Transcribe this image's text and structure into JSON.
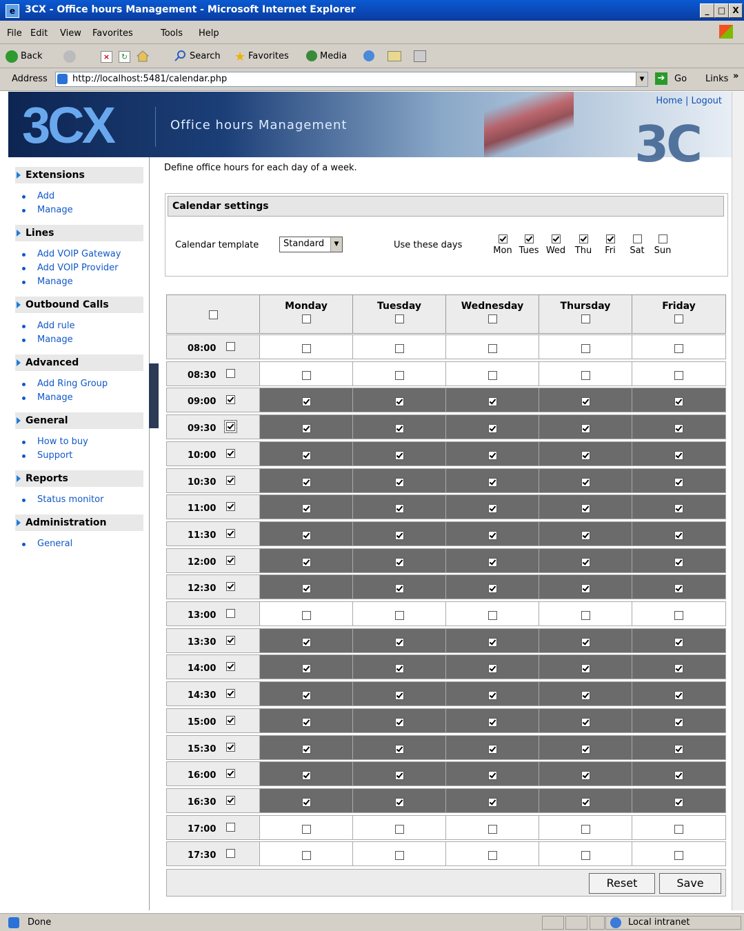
{
  "window": {
    "title": "3CX - Office hours Management - Microsoft Internet Explorer",
    "controls": [
      "_",
      "□",
      "X"
    ]
  },
  "menu": [
    "File",
    "Edit",
    "View",
    "Favorites",
    "Tools",
    "Help"
  ],
  "toolbar": {
    "back": "Back",
    "search": "Search",
    "favorites": "Favorites",
    "media": "Media"
  },
  "address": {
    "label": "Address",
    "url": "http://localhost:5481/calendar.php",
    "go": "Go",
    "links": "Links"
  },
  "header": {
    "logo": "3CX",
    "title": "Office hours Management",
    "home": "Home",
    "separator": "|",
    "logout": "Logout"
  },
  "sidebar": [
    {
      "label": "Extensions",
      "items": [
        "Add",
        "Manage"
      ]
    },
    {
      "label": "Lines",
      "items": [
        "Add VOIP Gateway",
        "Add VOIP Provider",
        "Manage"
      ]
    },
    {
      "label": "Outbound Calls",
      "items": [
        "Add rule",
        "Manage"
      ]
    },
    {
      "label": "Advanced",
      "items": [
        "Add Ring Group",
        "Manage"
      ]
    },
    {
      "label": "General",
      "items": [
        "How to buy",
        "Support"
      ]
    },
    {
      "label": "Reports",
      "items": [
        "Status monitor"
      ]
    },
    {
      "label": "Administration",
      "items": [
        "General"
      ]
    }
  ],
  "intro": "Define office hours for each day of a week.",
  "settings": {
    "title": "Calendar settings",
    "template_label": "Calendar template",
    "template_value": "Standard",
    "days_label": "Use these days",
    "days": [
      {
        "label": "Mon",
        "checked": true
      },
      {
        "label": "Tues",
        "checked": true
      },
      {
        "label": "Wed",
        "checked": true
      },
      {
        "label": "Thu",
        "checked": true
      },
      {
        "label": "Fri",
        "checked": true
      },
      {
        "label": "Sat",
        "checked": false
      },
      {
        "label": "Sun",
        "checked": false
      }
    ]
  },
  "grid": {
    "days": [
      "Monday",
      "Tuesday",
      "Wednesday",
      "Thursday",
      "Friday"
    ],
    "rows": [
      {
        "time": "08:00",
        "on": false
      },
      {
        "time": "08:30",
        "on": false
      },
      {
        "time": "09:00",
        "on": true
      },
      {
        "time": "09:30",
        "on": true
      },
      {
        "time": "10:00",
        "on": true
      },
      {
        "time": "10:30",
        "on": true
      },
      {
        "time": "11:00",
        "on": true
      },
      {
        "time": "11:30",
        "on": true
      },
      {
        "time": "12:00",
        "on": true
      },
      {
        "time": "12:30",
        "on": true
      },
      {
        "time": "13:00",
        "on": false
      },
      {
        "time": "13:30",
        "on": true
      },
      {
        "time": "14:00",
        "on": true
      },
      {
        "time": "14:30",
        "on": true
      },
      {
        "time": "15:00",
        "on": true
      },
      {
        "time": "15:30",
        "on": true
      },
      {
        "time": "16:00",
        "on": true
      },
      {
        "time": "16:30",
        "on": true
      },
      {
        "time": "17:00",
        "on": false
      },
      {
        "time": "17:30",
        "on": false
      }
    ],
    "reset": "Reset",
    "save": "Save"
  },
  "status": {
    "text": "Done",
    "zone": "Local intranet"
  }
}
